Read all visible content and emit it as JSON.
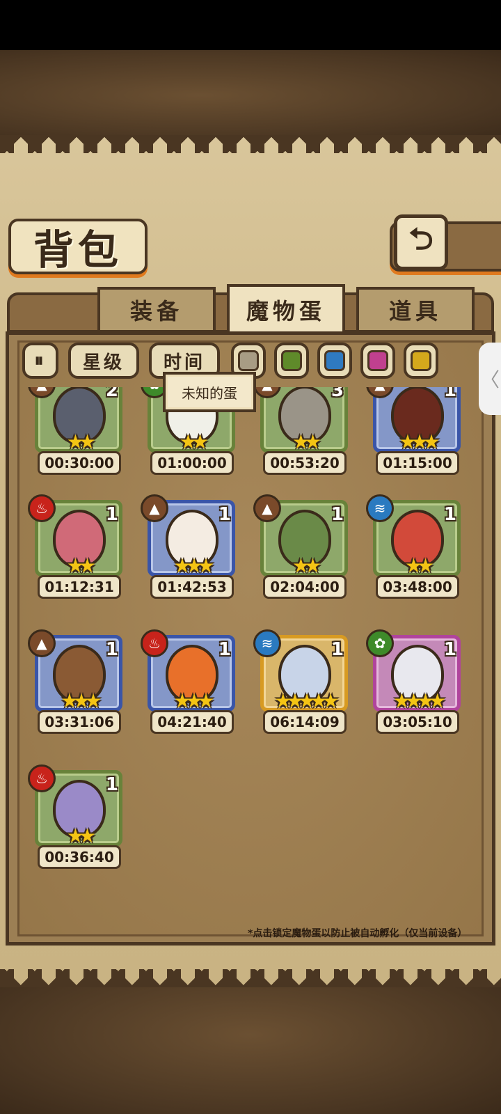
{
  "header": {
    "title": "背包",
    "back_icon": "⮌"
  },
  "tabs": [
    {
      "label": "装备",
      "active": false
    },
    {
      "label": "魔物蛋",
      "active": true
    },
    {
      "label": "道具",
      "active": false
    }
  ],
  "filters": {
    "sort_icon": "⏸",
    "star_label": "星级",
    "time_label": "时间",
    "colors": [
      "#a89c84",
      "#5f8a2a",
      "#2f7ac0",
      "#c0408f",
      "#d4a81c"
    ]
  },
  "tooltip": "未知的蛋",
  "eggs": [
    {
      "count": "2",
      "stars": "★★",
      "timer": "00:30:00",
      "frame": "green",
      "element": "earth",
      "element_icon": "▲",
      "color": "#5a5f6e"
    },
    {
      "count": "",
      "stars": "★★",
      "timer": "01:00:00",
      "frame": "green",
      "element": "wood",
      "element_icon": "✿",
      "color": "#f0f0e8"
    },
    {
      "count": "3",
      "stars": "★★",
      "timer": "00:53:20",
      "frame": "green",
      "element": "earth",
      "element_icon": "▲",
      "color": "#9a9488"
    },
    {
      "count": "1",
      "stars": "★★★",
      "timer": "01:15:00",
      "frame": "blue",
      "element": "earth",
      "element_icon": "▲",
      "color": "#6a2a1e"
    },
    {
      "count": "1",
      "stars": "★★",
      "timer": "01:12:31",
      "frame": "green",
      "element": "fire",
      "element_icon": "♨",
      "color": "#d06a78"
    },
    {
      "count": "1",
      "stars": "★★★",
      "timer": "01:42:53",
      "frame": "blue",
      "element": "earth",
      "element_icon": "▲",
      "color": "#f4ece2"
    },
    {
      "count": "1",
      "stars": "★★",
      "timer": "02:04:00",
      "frame": "green",
      "element": "earth",
      "element_icon": "▲",
      "color": "#6a8a48"
    },
    {
      "count": "1",
      "stars": "★★",
      "timer": "03:48:00",
      "frame": "green",
      "element": "water",
      "element_icon": "≋",
      "color": "#d24a3a"
    },
    {
      "count": "1",
      "stars": "★★★",
      "timer": "03:31:06",
      "frame": "blue",
      "element": "earth",
      "element_icon": "▲",
      "color": "#8a5a34"
    },
    {
      "count": "1",
      "stars": "★★★",
      "timer": "04:21:40",
      "frame": "blue",
      "element": "fire",
      "element_icon": "♨",
      "color": "#e8702a"
    },
    {
      "count": "1",
      "stars": "★★★★★",
      "timer": "06:14:09",
      "frame": "gold",
      "element": "water",
      "element_icon": "≋",
      "color": "#c8d4e8"
    },
    {
      "count": "1",
      "stars": "★★★★",
      "timer": "03:05:10",
      "frame": "pink",
      "element": "wood",
      "element_icon": "✿",
      "color": "#e8e8ee"
    },
    {
      "count": "1",
      "stars": "★★",
      "timer": "00:36:40",
      "frame": "green",
      "element": "fire",
      "element_icon": "♨",
      "color": "#9a8ac8"
    }
  ],
  "footer_note": "*点击锁定魔物蛋以防止被自动孵化（仅当前设备）",
  "side_handle": "〈"
}
